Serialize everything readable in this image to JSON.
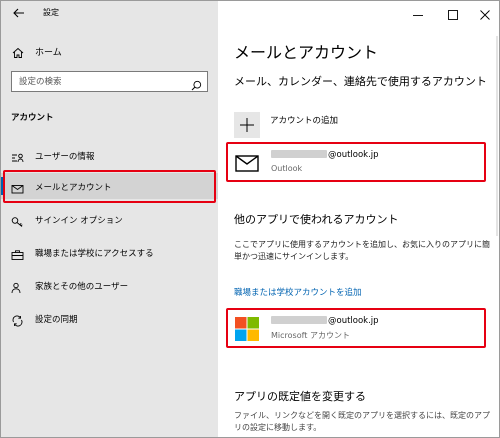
{
  "window": {
    "title": "設定",
    "controls": {
      "minimize": "minimize",
      "maximize": "maximize",
      "close": "close"
    }
  },
  "sidebar": {
    "home_label": "ホーム",
    "search_placeholder": "設定の検索",
    "section_label": "アカウント",
    "items": [
      {
        "label": "ユーザーの情報",
        "icon": "user-info-icon"
      },
      {
        "label": "メールとアカウント",
        "icon": "mail-icon",
        "selected": true
      },
      {
        "label": "サインイン オプション",
        "icon": "key-icon"
      },
      {
        "label": "職場または学校にアクセスする",
        "icon": "briefcase-icon"
      },
      {
        "label": "家族とその他のユーザー",
        "icon": "people-icon"
      },
      {
        "label": "設定の同期",
        "icon": "sync-icon"
      }
    ]
  },
  "main": {
    "title": "メールとアカウント",
    "email_section_heading": "メール、カレンダー、連絡先で使用するアカウント",
    "add_account_label": "アカウントの追加",
    "outlook_account": {
      "email_suffix": "@outlook.jp",
      "type": "Outlook"
    },
    "other_apps_heading": "他のアプリで使われるアカウント",
    "other_apps_description": "ここでアプリに使用するアカウントを追加し、お気に入りのアプリに簡単かつ迅速にサインインします。",
    "work_account_link": "職場または学校アカウントを追加",
    "microsoft_account": {
      "email_suffix": "@outlook.jp",
      "type": "Microsoft アカウント"
    },
    "defaults_heading": "アプリの既定値を変更する",
    "defaults_description": "ファイル、リンクなどを開く既定のアプリを選択するには、既定のアプリの設定に移動します。"
  },
  "colors": {
    "accent": "#0063b1",
    "highlight_red": "#e60012",
    "sidebar_bg": "#e6e6e6",
    "ms_red": "#f25022",
    "ms_green": "#7fba00",
    "ms_blue": "#00a4ef",
    "ms_yellow": "#ffb900"
  }
}
